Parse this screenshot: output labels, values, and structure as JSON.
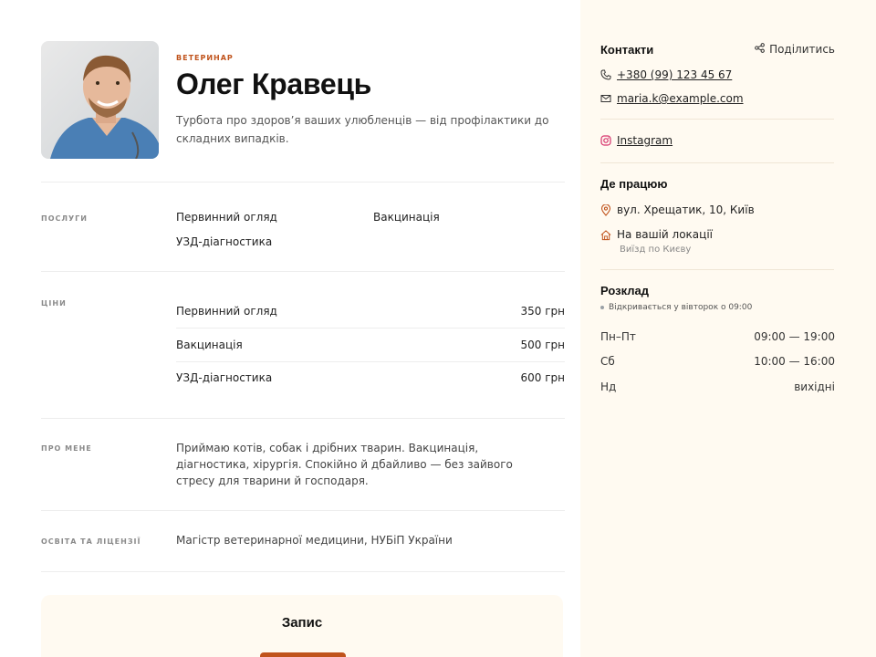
{
  "profile": {
    "role": "ВЕТЕРИНАР",
    "name": "Олег Кравець",
    "tagline": "Турбота про здоров’я ваших улюбленців — від профілактики до складних випадків."
  },
  "services": {
    "label": "ПОСЛУГИ",
    "items": [
      "Первинний огляд",
      "Вакцинація",
      "УЗД-діагностика"
    ]
  },
  "prices": {
    "label": "ЦІНИ",
    "rows": [
      {
        "name": "Первинний огляд",
        "price": "350 грн"
      },
      {
        "name": "Вакцинація",
        "price": "500 грн"
      },
      {
        "name": "УЗД-діагностика",
        "price": "600 грн"
      }
    ]
  },
  "about": {
    "label": "ПРО МЕНЕ",
    "text": "Приймаю котів, собак і дрібних тварин. Вакцинація, діагностика, хірургія. Спокійно й дбайливо — без зайвого стресу для тварини й господаря."
  },
  "education": {
    "label": "ОСВІТА ТА ЛІЦЕНЗІЇ",
    "text": "Магістр ветеринарної медицини, НУБіП України"
  },
  "booking": {
    "title": "Запис"
  },
  "contacts": {
    "title": "Контакти",
    "share": "Поділитись",
    "phone": "+380 (99) 123 45 67",
    "email": "maria.k@example.com",
    "instagram": "Instagram"
  },
  "work": {
    "title": "Де працюю",
    "address": "вул. Хрещатик, 10, Київ",
    "home_visit": "На вашій локації",
    "home_visit_sub": "Виїзд по Києву"
  },
  "schedule": {
    "title": "Розклад",
    "status": "Відкривається у вівторок о 09:00",
    "rows": [
      {
        "day": "Пн–Пт",
        "time": "09:00 — 19:00"
      },
      {
        "day": "Сб",
        "time": "10:00 — 16:00"
      },
      {
        "day": "Нд",
        "time": "вихідні"
      }
    ]
  },
  "colors": {
    "accent": "#c0531c",
    "sidebar_bg": "#fffaf1"
  }
}
